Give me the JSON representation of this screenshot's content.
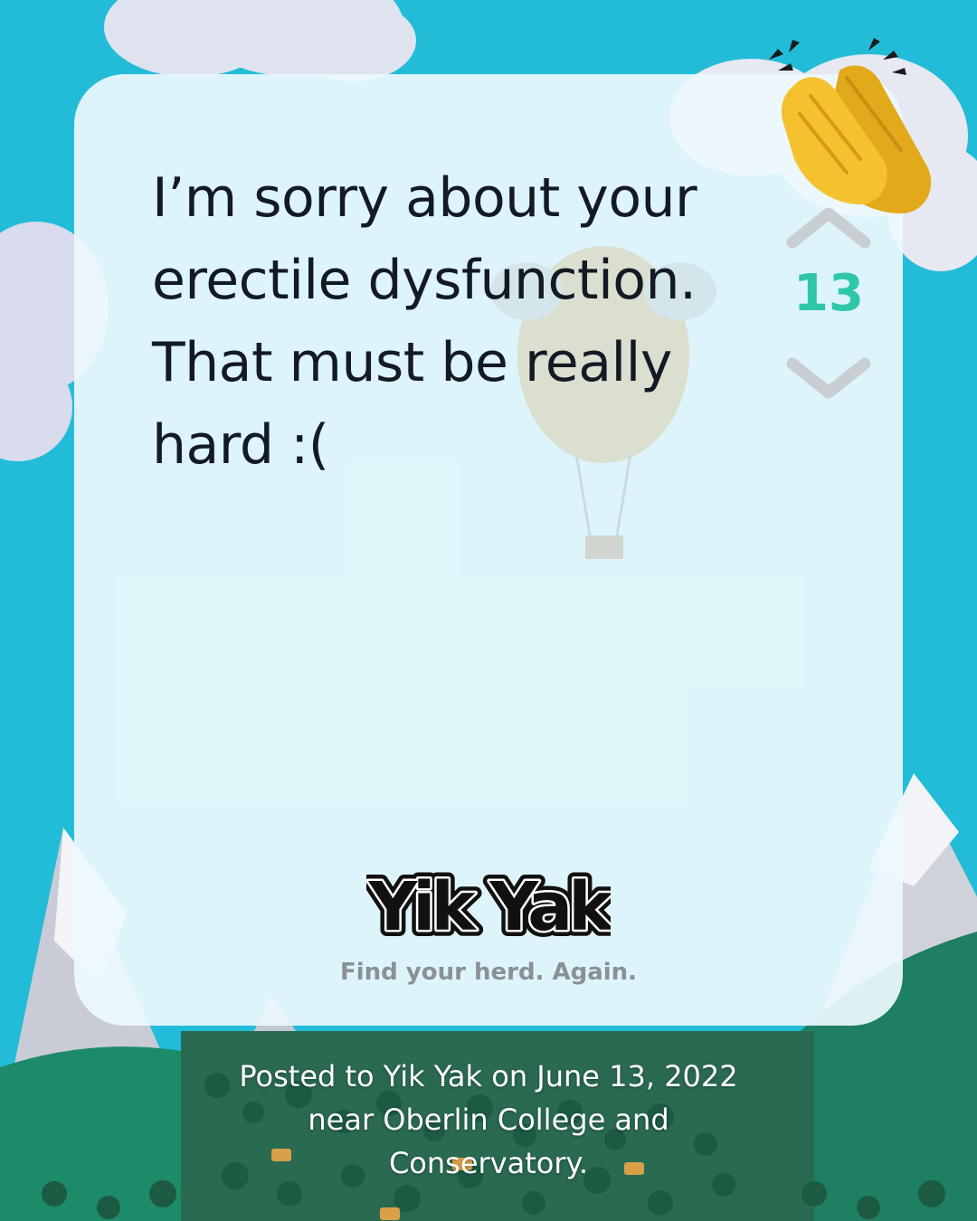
{
  "post": {
    "text_lines": [
      "I’m sorry about your",
      "erectile dysfunction.",
      "That must be really",
      "hard :("
    ],
    "score": "13"
  },
  "brand": {
    "logo_text": "Yik Yak",
    "tagline": "Find your herd. Again."
  },
  "caption": {
    "lines": [
      "Posted to Yik Yak on June 13, 2022",
      "near Oberlin College and",
      "Conservatory."
    ]
  },
  "icons": {
    "upvote": "chevron-up-icon",
    "downvote": "chevron-down-icon",
    "clap": "clapping-hands-emoji"
  },
  "colors": {
    "sky": "#22bcd8",
    "card": "#ecf9fd",
    "score": "#2ec7a8",
    "text": "#141a24",
    "tagline": "#8a9094"
  }
}
